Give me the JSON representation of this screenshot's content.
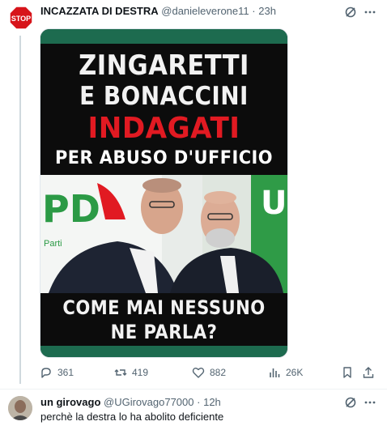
{
  "post": {
    "author_name": "INCAZZATA DI DESTRA",
    "handle": "@danieleverone11",
    "separator": "·",
    "time": "23h",
    "avatar_sign": "STOP",
    "media": {
      "line1": "ZINGARETTI",
      "line2": "E BONACCINI",
      "line3": "INDAGATI",
      "line4": "PER ABUSO D'UFFICIO",
      "line5": "COME MAI NESSUNO",
      "line6": "NE PARLA?",
      "logo_left": "PD",
      "logo_left_small": "Parti",
      "logo_right": "U"
    },
    "actions": {
      "replies": "361",
      "reposts": "419",
      "likes": "882",
      "views": "26K"
    }
  },
  "reply": {
    "author_name": "un girovago",
    "handle": "@UGirovago77000",
    "separator": "·",
    "time": "12h",
    "text": "perchè la destra lo ha abolito deficiente"
  },
  "colors": {
    "text_primary": "#0f1419",
    "text_secondary": "#536471",
    "headline_red": "#e11a22",
    "pd_green": "#1d6b4f"
  },
  "icons": {
    "grok": "grok-icon",
    "more": "more-icon",
    "reply": "reply-icon",
    "repost": "repost-icon",
    "like": "heart-icon",
    "views": "views-icon",
    "bookmark": "bookmark-icon",
    "share": "share-icon"
  }
}
